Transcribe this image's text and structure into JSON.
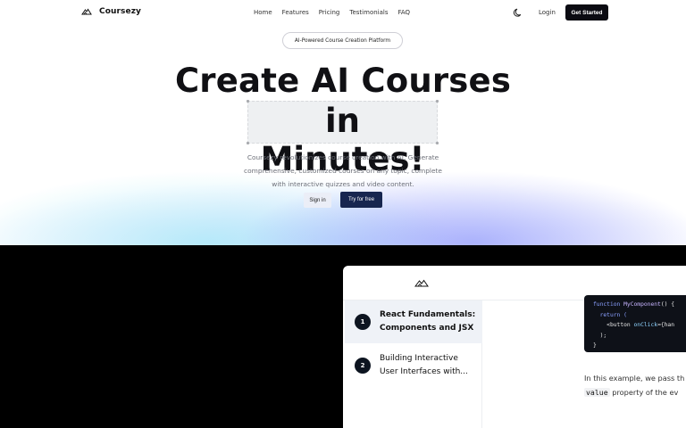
{
  "nav": {
    "brand": "Coursezy",
    "links": [
      "Home",
      "Features",
      "Pricing",
      "Testimonials",
      "FAQ"
    ],
    "login": "Login",
    "cta": "Get Started"
  },
  "hero": {
    "badge": "AI-Powered Course Creation Platform",
    "title_line1": "Create AI Courses",
    "title_line2": "in Minutes!",
    "description": "Coursezy revolutionizes course creation with AI. Generate comprehensive, customized courses on any topic, complete with interactive quizzes and video content.",
    "signin": "Sign in",
    "try_free": "Try for free"
  },
  "preview": {
    "lessons": [
      {
        "number": "1",
        "title": "React Fundamentals: Components and JSX",
        "active": true
      },
      {
        "number": "2",
        "title": "Building Interactive User Interfaces with...",
        "active": false
      }
    ],
    "code_lines": {
      "l1_kw": "function",
      "l1_fn": "MyComponent",
      "l1_rest": "() {",
      "l2": "return (",
      "l3_tag": "<button",
      "l3_attr": "onClick",
      "l3_rest": "={han",
      "l4": ");",
      "l5": "}"
    },
    "para_text_1": "In this example, we pass th",
    "para_code": "value",
    "para_text_2": " property of the ev"
  },
  "colors": {
    "primary": "#0b0b12",
    "button_dark": "#17264f",
    "code_bg": "#0e1118",
    "active_lesson": "#eff2f7"
  }
}
